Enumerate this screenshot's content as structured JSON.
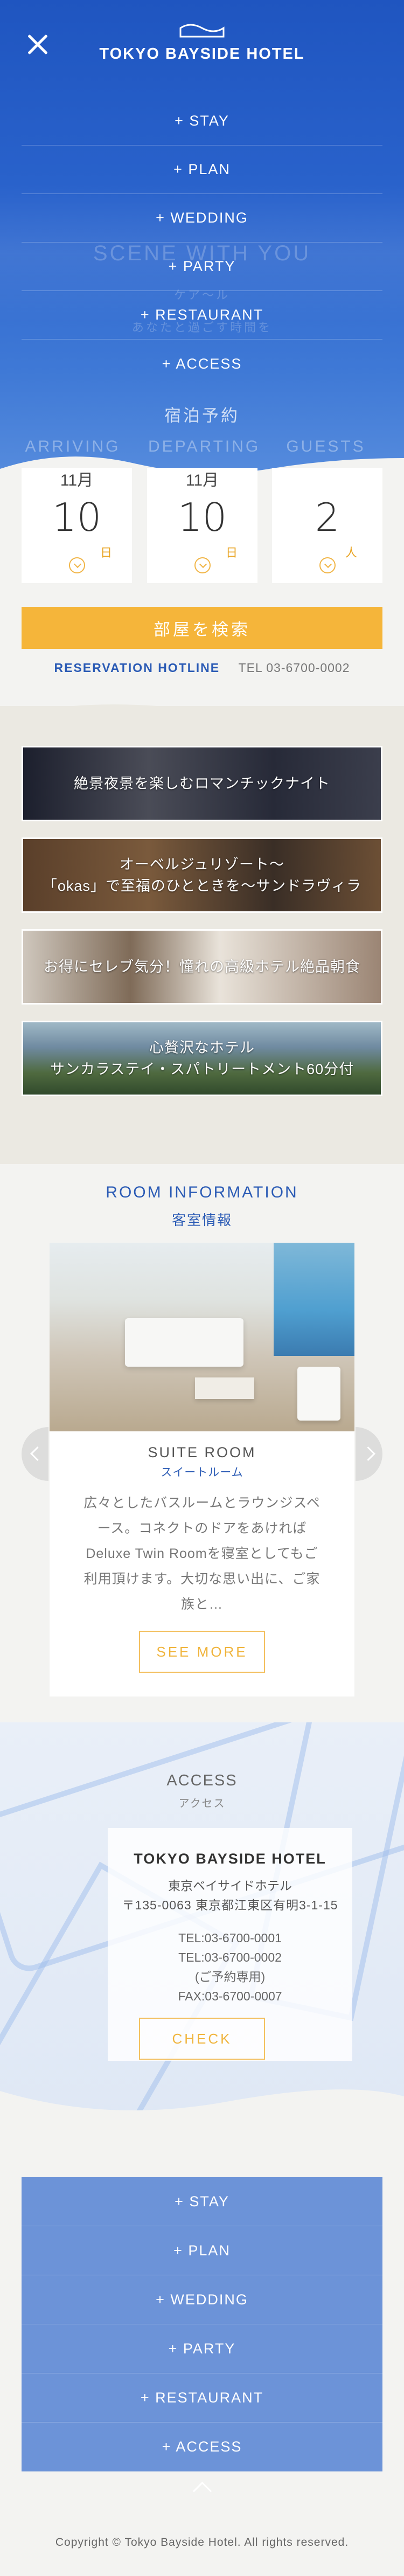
{
  "header": {
    "brand": "TOKYO BAYSIDE HOTEL",
    "close_icon": "close-icon",
    "logo_icon": "wave-logo-icon"
  },
  "menu": [
    "+ STAY",
    "+ PLAN",
    "+ WEDDING",
    "+ PARTY",
    "+ RESTAURANT",
    "+ ACCESS"
  ],
  "hero": {
    "ghost_scene": "SCENE WITH YOU",
    "ghost_sub1": "ケア〜ル",
    "ghost_sub2": "あなたと過ごす時間を"
  },
  "booking": {
    "title": "宿泊予約",
    "labels": [
      "ARRIVING",
      "DEPARTING",
      "GUESTS"
    ],
    "arriving": {
      "month": "11月",
      "day": "10",
      "unit": "日"
    },
    "departing": {
      "month": "11月",
      "day": "10",
      "unit": "日"
    },
    "guests": {
      "count": "2",
      "unit": "人"
    },
    "search_label": "部屋を検索",
    "hotline_label": "RESERVATION  HOTLINE",
    "hotline_tel": "TEL 03-6700-0002"
  },
  "banners": [
    {
      "line1": "絶景夜景を楽しむロマンチックナイト",
      "line2": ""
    },
    {
      "line1": "オーベルジュリゾート〜",
      "line2": "「okas」で至福のひとときを〜サンドラヴィラ"
    },
    {
      "line1": "お得にセレブ気分！憧れの高級ホテル絶品朝食",
      "line2": ""
    },
    {
      "line1": "心贅沢なホテル",
      "line2": "サンカラステイ・スパトリートメント60分付"
    }
  ],
  "room": {
    "title_en": "ROOM INFORMATION",
    "title_jp": "客室情報",
    "name": "SUITE ROOM",
    "name_jp": "スイートルーム",
    "desc": "広々としたバスルームとラウンジスペース。コネクトのドアをあければDeluxe Twin Roomを寝室としてもご利用頂けます。大切な思い出に、ご家族と…",
    "more_label": "SEE MORE"
  },
  "access": {
    "title_en": "ACCESS",
    "title_jp": "アクセス",
    "hotel_name": "TOKYO BAYSIDE HOTEL",
    "hotel_name_jp": "東京ベイサイドホテル",
    "address": "〒135-0063 東京都江東区有明3-1-15",
    "tel1": "TEL:03-6700-0001",
    "tel2": "TEL:03-6700-0002",
    "tel2_note": "(ご予約専用)",
    "fax": "FAX:03-6700-0007",
    "check_label": "CHECK"
  },
  "footer": {
    "menu": [
      "+ STAY",
      "+ PLAN",
      "+ WEDDING",
      "+ PARTY",
      "+ RESTAURANT",
      "+ ACCESS"
    ],
    "pagetop_icon": "chevron-up-icon",
    "copyright": "Copyright © Tokyo Bayside Hotel. All rights reserved."
  },
  "colors": {
    "brand_blue": "#2b5bb5",
    "menu_blue": "#6c93d8",
    "accent_orange": "#f5b53a"
  }
}
